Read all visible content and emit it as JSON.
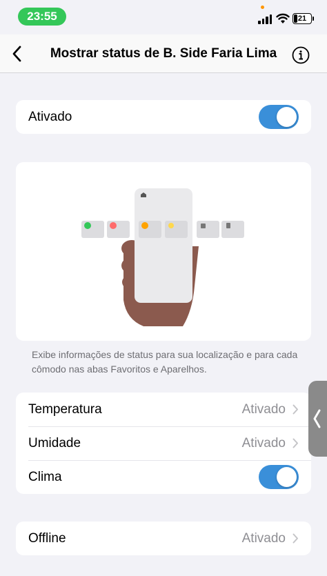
{
  "status_bar": {
    "time": "23:55",
    "battery_level": "21",
    "signal_icon": "cellular-signal-icon",
    "wifi_icon": "wifi-icon",
    "battery_icon": "battery-icon"
  },
  "nav": {
    "title": "Mostrar status de B. Side Faria Lima",
    "back_icon": "chevron-left-icon",
    "info_icon": "info-icon"
  },
  "enabled_section": {
    "label": "Ativado",
    "toggle_on": true
  },
  "illustration": {
    "description_text": "Exibe informações de status para sua localização e para cada cômodo nas abas Favoritos e Aparelhos."
  },
  "settings": [
    {
      "label": "Temperatura",
      "value": "Ativado",
      "type": "disclosure"
    },
    {
      "label": "Umidade",
      "value": "Ativado",
      "type": "disclosure"
    },
    {
      "label": "Clima",
      "type": "toggle",
      "toggle_on": true
    }
  ],
  "offline": {
    "label": "Offline",
    "value": "Ativado"
  },
  "colors": {
    "accent": "#3a8fd9",
    "time_pill": "#34c759",
    "background": "#f2f2f7",
    "secondary_text": "#8e8e93",
    "skin": "#8b5a4e"
  }
}
